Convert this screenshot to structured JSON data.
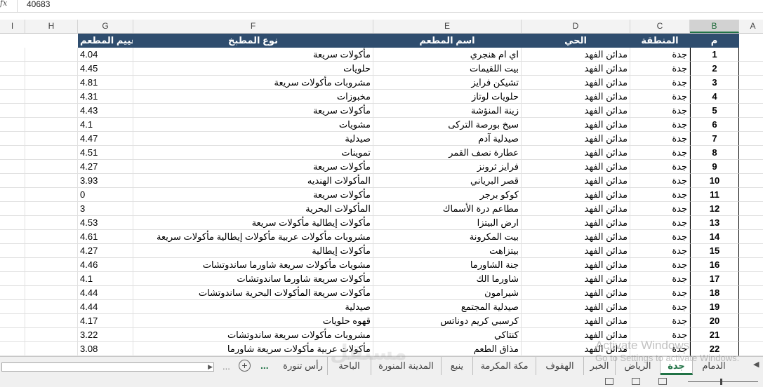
{
  "formula": {
    "fx": "fx",
    "value": "40683"
  },
  "columns": [
    {
      "key": "I",
      "label": "I"
    },
    {
      "key": "H",
      "label": "H"
    },
    {
      "key": "G",
      "label": "G"
    },
    {
      "key": "F",
      "label": "F"
    },
    {
      "key": "E",
      "label": "E"
    },
    {
      "key": "D",
      "label": "D"
    },
    {
      "key": "C",
      "label": "C"
    },
    {
      "key": "B",
      "label": "B"
    },
    {
      "key": "A",
      "label": "A"
    }
  ],
  "header": {
    "rating": "تقييم المطعم",
    "cuisine": "نوع المطبخ",
    "name": "اسم المطعم",
    "district": "الحي",
    "region": "المنطقة",
    "num": "م"
  },
  "rows": [
    {
      "num": "1",
      "region": "جدة",
      "district": "مدائن الفهد",
      "name": "اي ام هنجري",
      "cuisine": "مأكولات سريعة",
      "rating": "4.04"
    },
    {
      "num": "2",
      "region": "جدة",
      "district": "مدائن الفهد",
      "name": "بيت اللقيمات",
      "cuisine": "حلويات",
      "rating": "4.45"
    },
    {
      "num": "3",
      "region": "جدة",
      "district": "مدائن الفهد",
      "name": "تشيكن فرايز",
      "cuisine": "مشروبات مأكولات سريعة",
      "rating": "4.81"
    },
    {
      "num": "4",
      "region": "جدة",
      "district": "مدائن الفهد",
      "name": "حلويات لوتاز",
      "cuisine": "مخبوزات",
      "rating": "4.31"
    },
    {
      "num": "5",
      "region": "جدة",
      "district": "مدائن الفهد",
      "name": "زينة المنؤشة",
      "cuisine": "مأكولات سريعة",
      "rating": "4.43"
    },
    {
      "num": "6",
      "region": "جدة",
      "district": "مدائن الفهد",
      "name": "سيخ بورصة الترکی",
      "cuisine": "مشويات",
      "rating": "4.1"
    },
    {
      "num": "7",
      "region": "جدة",
      "district": "مدائن الفهد",
      "name": "صيدلية آدم",
      "cuisine": "صيدلية",
      "rating": "4.47"
    },
    {
      "num": "8",
      "region": "جدة",
      "district": "مدائن الفهد",
      "name": "عطارة نصف القمر",
      "cuisine": "تموينات",
      "rating": "4.51"
    },
    {
      "num": "9",
      "region": "جدة",
      "district": "مدائن الفهد",
      "name": "فرايز ثرونز",
      "cuisine": "مأكولات سريعة",
      "rating": "4.27"
    },
    {
      "num": "10",
      "region": "جدة",
      "district": "مدائن الفهد",
      "name": "قصر البرياني",
      "cuisine": "المأكولات الهنديه",
      "rating": "3.93"
    },
    {
      "num": "11",
      "region": "جدة",
      "district": "مدائن الفهد",
      "name": "كوكو برجر",
      "cuisine": "مأكولات سريعة",
      "rating": "0"
    },
    {
      "num": "12",
      "region": "جدة",
      "district": "مدائن الفهد",
      "name": "مطاعم درة الأسماك",
      "cuisine": "المأكولات البحرية",
      "rating": "3"
    },
    {
      "num": "13",
      "region": "جدة",
      "district": "مدائن الفهد",
      "name": "ارض البيتزا",
      "cuisine": "مأكولات إيطالية مأكولات سريعة",
      "rating": "4.53"
    },
    {
      "num": "14",
      "region": "جدة",
      "district": "مدائن الفهد",
      "name": "بيت المكرونة",
      "cuisine": "مشروبات مأكولات عربية مأكولات إيطالية مأكولات سريعة",
      "rating": "4.61"
    },
    {
      "num": "15",
      "region": "جدة",
      "district": "مدائن الفهد",
      "name": "بيتزاهت",
      "cuisine": "مأكولات إيطالية",
      "rating": "4.27"
    },
    {
      "num": "16",
      "region": "جدة",
      "district": "مدائن الفهد",
      "name": "جنة الشاورما",
      "cuisine": "مشويات مأكولات سريعة شاورما ساندوتشات",
      "rating": "4.46"
    },
    {
      "num": "17",
      "region": "جدة",
      "district": "مدائن الفهد",
      "name": "شاورما الك",
      "cuisine": "مأكولات سريعة شاورما ساندوتشات",
      "rating": "4.1"
    },
    {
      "num": "18",
      "region": "جدة",
      "district": "مدائن الفهد",
      "name": "شيرامون",
      "cuisine": "مأكولات سريعة المأكولات البحرية ساندوتشات",
      "rating": "4.44"
    },
    {
      "num": "19",
      "region": "جدة",
      "district": "مدائن الفهد",
      "name": "صيدلية المجتمع",
      "cuisine": "صيدلية",
      "rating": "4.44"
    },
    {
      "num": "20",
      "region": "جدة",
      "district": "مدائن الفهد",
      "name": "كرسبي كريم دوناتس",
      "cuisine": "قهوه حلويات",
      "rating": "4.17"
    },
    {
      "num": "21",
      "region": "جدة",
      "district": "مدائن الفهد",
      "name": "كنتاكي",
      "cuisine": "مشروبات مأكولات سريعة ساندوتشات",
      "rating": "3.22"
    },
    {
      "num": "22",
      "region": "جدة",
      "district": "مدائن الفهد",
      "name": "مذاق الطعم",
      "cuisine": "مأكولات عربية مأكولات سريعة شاورما",
      "rating": "3.08"
    }
  ],
  "tabs": {
    "t1": "الدمام",
    "t2": "جدة",
    "t3": "الرياض",
    "t4": "الخبر",
    "t5": "الهفوف",
    "t6": "مكة المكرمة",
    "t7": "ينبع",
    "t8": "المدينة المنورة",
    "t9": "الباحة",
    "t10": "رأس تنورة"
  },
  "sheet_nav": {
    "more": "...",
    "more_left": "...",
    "add": "+"
  },
  "watermark": {
    "line1": "Activate Windows",
    "line2": "Go to Settings to activate Windows.",
    "site": "مستقل"
  },
  "colors": {
    "header_bg": "#2f4d6e",
    "accent": "#217346"
  }
}
